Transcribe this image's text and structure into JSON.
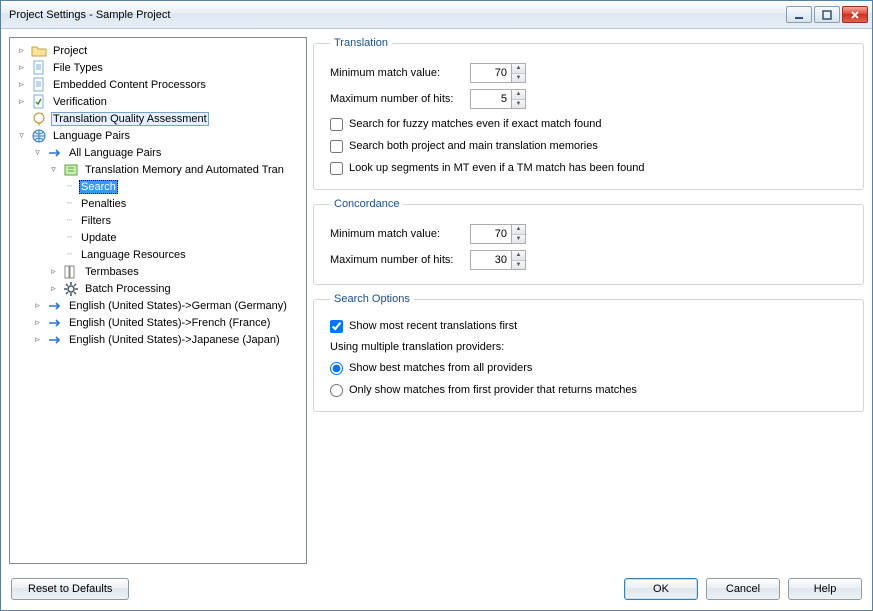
{
  "title": "Project Settings - Sample Project",
  "tree": {
    "project": "Project",
    "fileTypes": "File Types",
    "embedded": "Embedded Content Processors",
    "verification": "Verification",
    "tqa": "Translation Quality Assessment",
    "langPairs": "Language Pairs",
    "allLangPairs": "All Language Pairs",
    "tmAuto": "Translation Memory and Automated Tran",
    "search": "Search",
    "penalties": "Penalties",
    "filters": "Filters",
    "update": "Update",
    "langRes": "Language Resources",
    "termbases": "Termbases",
    "batch": "Batch Processing",
    "pair_de": "English (United States)->German (Germany)",
    "pair_fr": "English (United States)->French (France)",
    "pair_ja": "English (United States)->Japanese (Japan)"
  },
  "translation": {
    "legend": "Translation",
    "minMatchLabel": "Minimum match value:",
    "minMatch": "70",
    "maxHitsLabel": "Maximum number of hits:",
    "maxHits": "5",
    "opt_fuzzy": "Search for fuzzy matches even if exact match found",
    "opt_both": "Search both project and main translation memories",
    "opt_mt": "Look up segments in MT even if a TM match has been found"
  },
  "concordance": {
    "legend": "Concordance",
    "minMatchLabel": "Minimum match value:",
    "minMatch": "70",
    "maxHitsLabel": "Maximum number of hits:",
    "maxHits": "30"
  },
  "searchOptions": {
    "legend": "Search Options",
    "showRecent": "Show most recent translations first",
    "multiProviders": "Using multiple translation providers:",
    "radio_best": "Show best matches from all providers",
    "radio_first": "Only show matches from first provider that returns matches"
  },
  "footer": {
    "reset": "Reset to Defaults",
    "ok": "OK",
    "cancel": "Cancel",
    "help": "Help"
  }
}
